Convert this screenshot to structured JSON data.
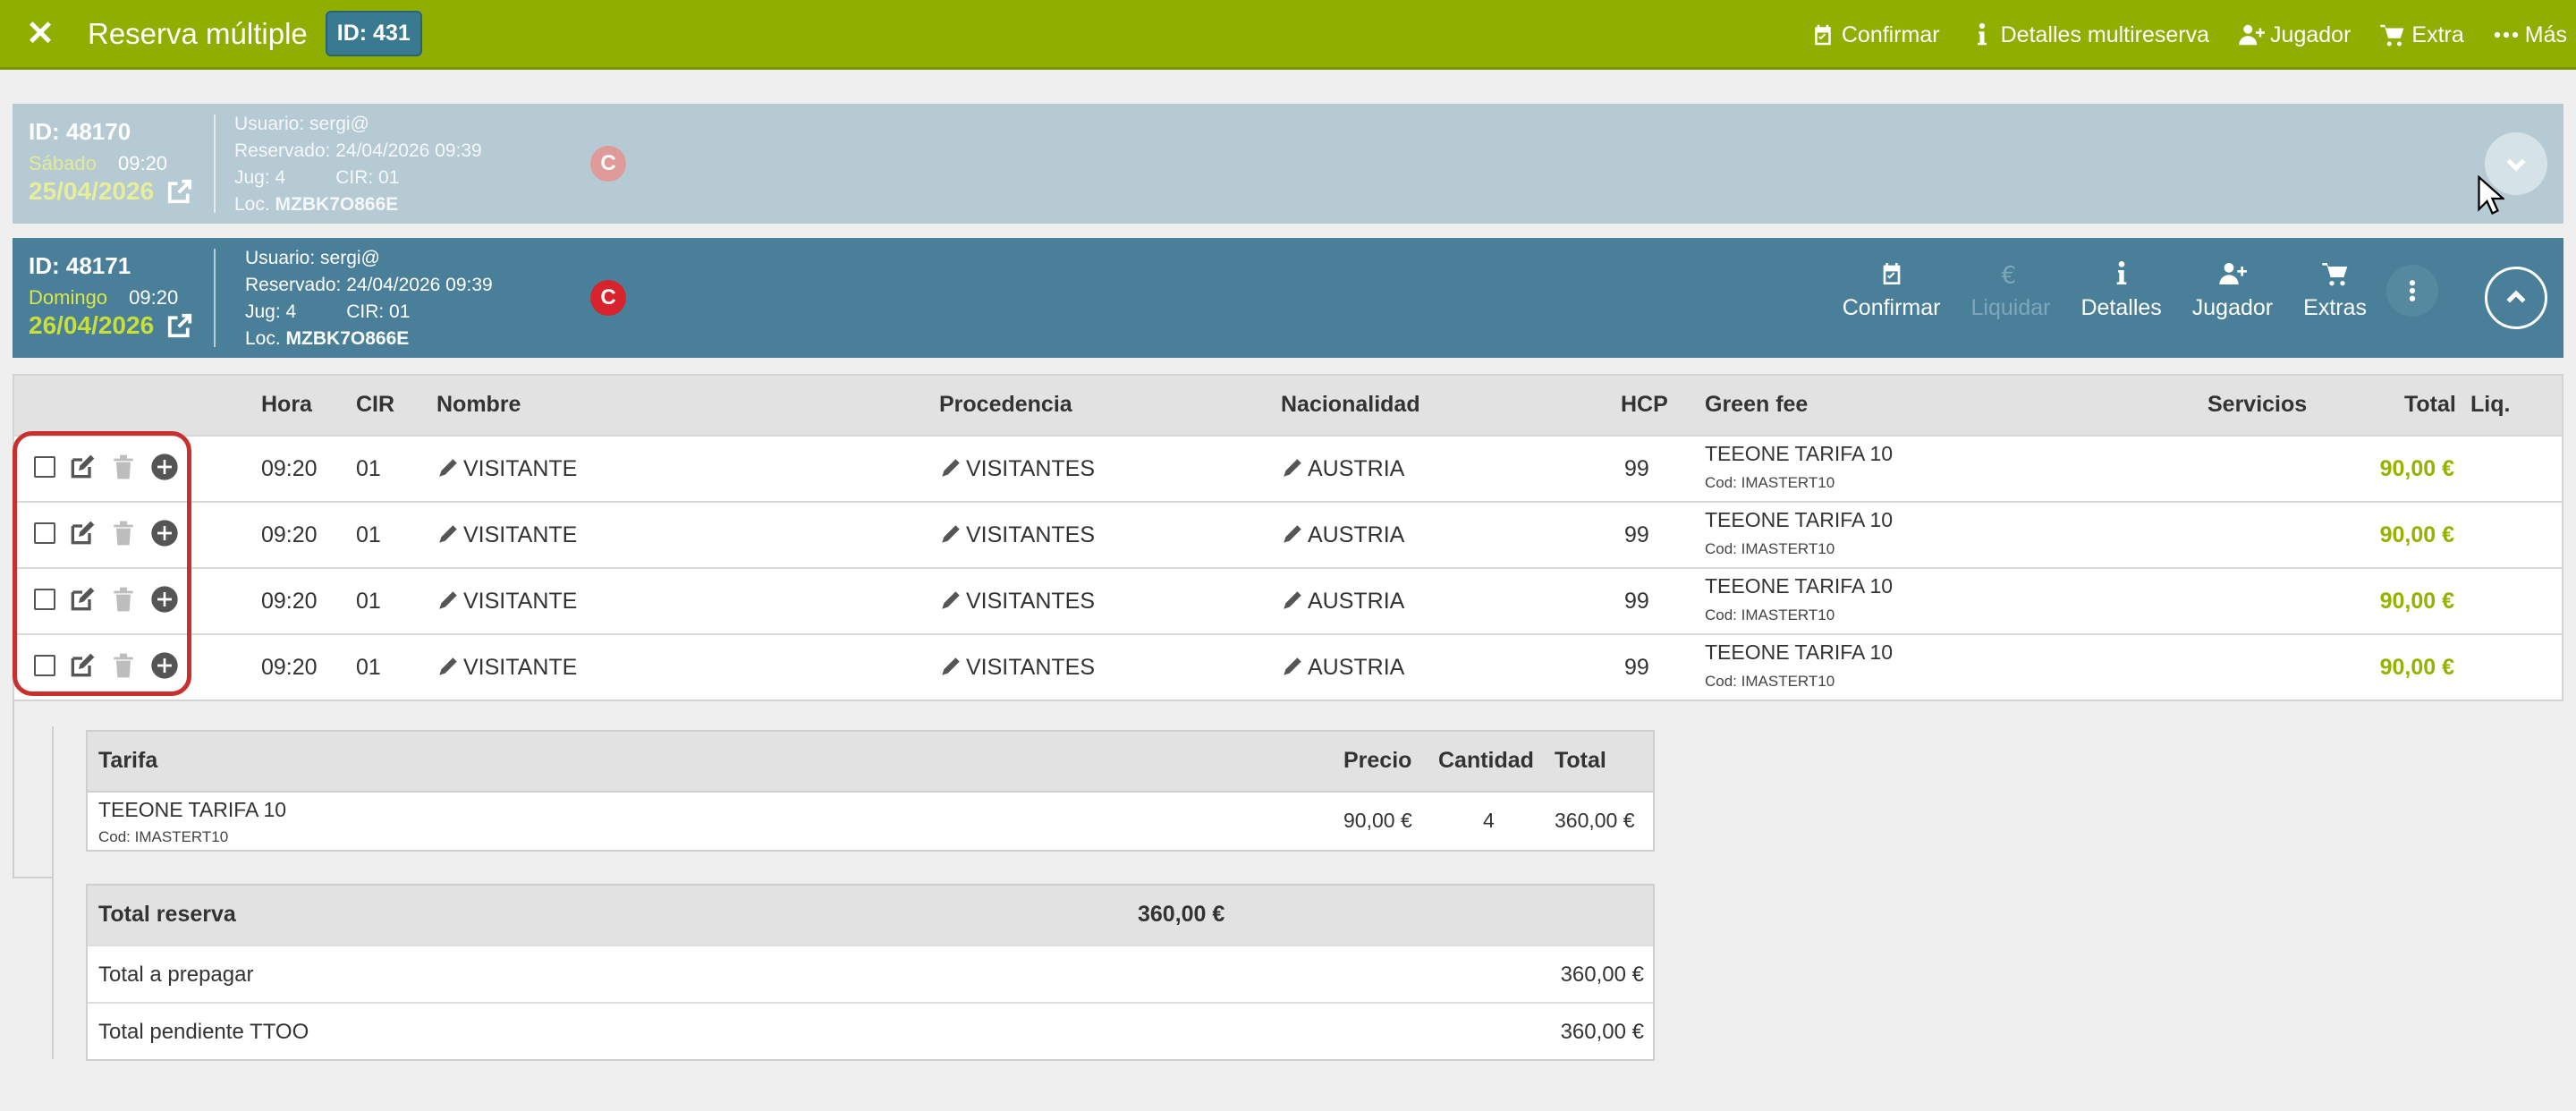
{
  "topbar": {
    "title": "Reserva múltiple",
    "id_badge": "ID: 431",
    "actions": {
      "confirmar": "Confirmar",
      "detalles": "Detalles multireserva",
      "jugador": "Jugador",
      "extra": "Extra",
      "mas": "Más"
    }
  },
  "bookings": [
    {
      "id": "ID: 48170",
      "day": "Sábado",
      "time": "09:20",
      "date": "25/04/2026",
      "usuario": "Usuario: sergi@",
      "reservado": "Reservado: 24/04/2026 09:39",
      "jug": "Jug: 4",
      "cir": "CIR: 01",
      "loc_label": "Loc.",
      "loc_value": "MZBK7O866E",
      "badge": "C",
      "expanded": false
    },
    {
      "id": "ID: 48171",
      "day": "Domingo",
      "time": "09:20",
      "date": "26/04/2026",
      "usuario": "Usuario: sergi@",
      "reservado": "Reservado: 24/04/2026 09:39",
      "jug": "Jug: 4",
      "cir": "CIR: 01",
      "loc_label": "Loc.",
      "loc_value": "MZBK7O866E",
      "badge": "C",
      "expanded": true,
      "actions": {
        "confirmar": "Confirmar",
        "liquidar": "Liquidar",
        "detalles": "Detalles",
        "jugador": "Jugador",
        "extras": "Extras"
      }
    }
  ],
  "players_table": {
    "headers": {
      "hora": "Hora",
      "cir": "CIR",
      "nombre": "Nombre",
      "procedencia": "Procedencia",
      "nacionalidad": "Nacionalidad",
      "hcp": "HCP",
      "green_fee": "Green fee",
      "servicios": "Servicios",
      "total": "Total",
      "liq": "Liq."
    },
    "rows": [
      {
        "hora": "09:20",
        "cir": "01",
        "nombre": "VISITANTE",
        "procedencia": "VISITANTES",
        "nacionalidad": "AUSTRIA",
        "hcp": "99",
        "green_fee": "TEEONE TARIFA 10",
        "green_fee_code": "Cod: IMASTERT10",
        "total": "90,00 €"
      },
      {
        "hora": "09:20",
        "cir": "01",
        "nombre": "VISITANTE",
        "procedencia": "VISITANTES",
        "nacionalidad": "AUSTRIA",
        "hcp": "99",
        "green_fee": "TEEONE TARIFA 10",
        "green_fee_code": "Cod: IMASTERT10",
        "total": "90,00 €"
      },
      {
        "hora": "09:20",
        "cir": "01",
        "nombre": "VISITANTE",
        "procedencia": "VISITANTES",
        "nacionalidad": "AUSTRIA",
        "hcp": "99",
        "green_fee": "TEEONE TARIFA 10",
        "green_fee_code": "Cod: IMASTERT10",
        "total": "90,00 €"
      },
      {
        "hora": "09:20",
        "cir": "01",
        "nombre": "VISITANTE",
        "procedencia": "VISITANTES",
        "nacionalidad": "AUSTRIA",
        "hcp": "99",
        "green_fee": "TEEONE TARIFA 10",
        "green_fee_code": "Cod: IMASTERT10",
        "total": "90,00 €"
      }
    ]
  },
  "tarifa_table": {
    "headers": {
      "tarifa": "Tarifa",
      "precio": "Precio",
      "cantidad": "Cantidad",
      "total": "Total"
    },
    "row": {
      "tarifa": "TEEONE TARIFA 10",
      "code": "Cod: IMASTERT10",
      "precio": "90,00 €",
      "cantidad": "4",
      "total": "360,00 €"
    }
  },
  "summary": {
    "total_reserva_label": "Total reserva",
    "total_reserva_value": "360,00 €",
    "prepagar_label": "Total a prepagar",
    "prepagar_value": "360,00 €",
    "pendiente_label": "Total pendiente TTOO",
    "pendiente_value": "360,00 €"
  },
  "colors": {
    "topbar": "#8fae00",
    "booking_collapsed": "#b6cad3",
    "booking_expanded": "#4a7f99",
    "price_green": "#94b300",
    "badge_red": "#d6232c",
    "highlight_red": "#c8302e"
  }
}
